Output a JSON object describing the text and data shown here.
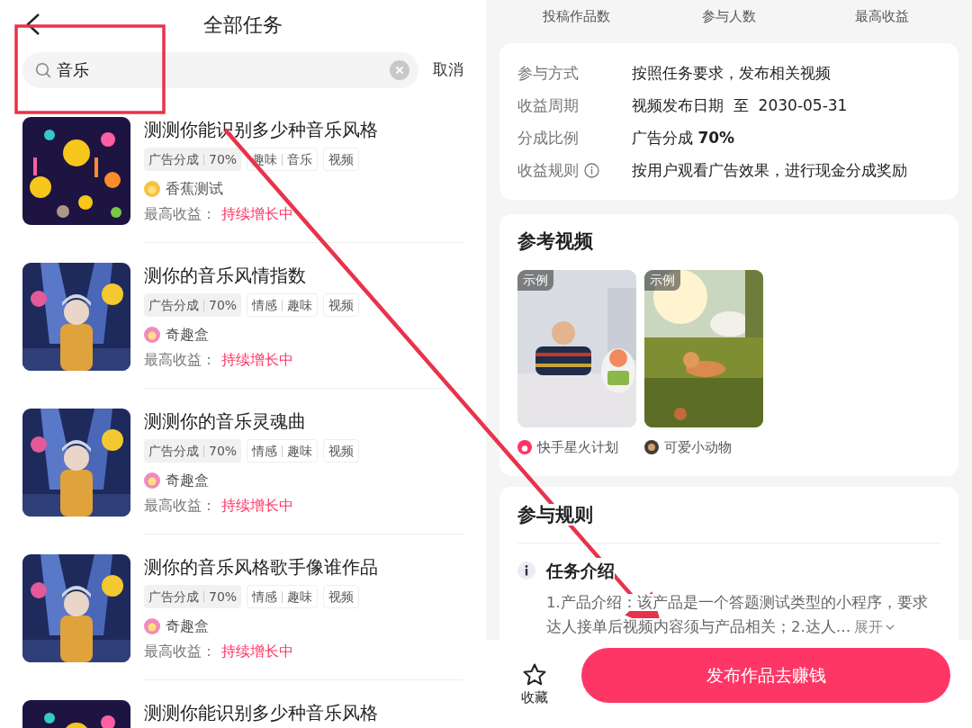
{
  "left": {
    "title": "全部任务",
    "search": {
      "value": "音乐"
    },
    "cancel": "取消",
    "tasks": [
      {
        "title": "测测你能识别多少种音乐风格",
        "tags": [
          {
            "kind": "share",
            "parts": [
              "广告分成",
              "70%"
            ]
          },
          {
            "kind": "plain",
            "parts": [
              "趣味",
              "音乐"
            ]
          },
          {
            "kind": "plain",
            "parts": [
              "视频"
            ]
          }
        ],
        "author": "香蕉测试",
        "earnings_label": "最高收益：",
        "earnings_value": "持续增长中"
      },
      {
        "title": "测你的音乐风情指数",
        "tags": [
          {
            "kind": "share",
            "parts": [
              "广告分成",
              "70%"
            ]
          },
          {
            "kind": "plain",
            "parts": [
              "情感",
              "趣味"
            ]
          },
          {
            "kind": "plain",
            "parts": [
              "视频"
            ]
          }
        ],
        "author": "奇趣盒",
        "earnings_label": "最高收益：",
        "earnings_value": "持续增长中"
      },
      {
        "title": "测测你的音乐灵魂曲",
        "tags": [
          {
            "kind": "share",
            "parts": [
              "广告分成",
              "70%"
            ]
          },
          {
            "kind": "plain",
            "parts": [
              "情感",
              "趣味"
            ]
          },
          {
            "kind": "plain",
            "parts": [
              "视频"
            ]
          }
        ],
        "author": "奇趣盒",
        "earnings_label": "最高收益：",
        "earnings_value": "持续增长中"
      },
      {
        "title": "测你的音乐风格歌手像谁作品",
        "tags": [
          {
            "kind": "share",
            "parts": [
              "广告分成",
              "70%"
            ]
          },
          {
            "kind": "plain",
            "parts": [
              "情感",
              "趣味"
            ]
          },
          {
            "kind": "plain",
            "parts": [
              "视频"
            ]
          }
        ],
        "author": "奇趣盒",
        "earnings_label": "最高收益：",
        "earnings_value": "持续增长中"
      },
      {
        "title": "测测你能识别多少种音乐风格"
      }
    ]
  },
  "right": {
    "stats": [
      "投稿作品数",
      "参与人数",
      "最高收益"
    ],
    "details": [
      {
        "label": "参与方式",
        "value": "按照任务要求，发布相关视频",
        "info": false
      },
      {
        "label": "收益周期",
        "value": "视频发布日期  至  2030-05-31",
        "info": false
      },
      {
        "label": "分成比例",
        "value": "广告分成 **70%**",
        "info": false
      },
      {
        "label": "收益规则",
        "value": "按用户观看广告效果，进行现金分成奖励",
        "info": true
      }
    ],
    "reference": {
      "title": "参考视频",
      "videos": [
        {
          "badge": "示例",
          "author": "快手星火计划"
        },
        {
          "badge": "示例",
          "author": "可爱小动物"
        }
      ]
    },
    "rules": {
      "title": "参与规则",
      "section_title": "任务介绍",
      "text": "1.产品介绍：该产品是一个答题测试类型的小程序，要求达人接单后视频内容须与产品相关；2.达人…",
      "expand": "展开"
    },
    "bottom": {
      "favorite": "收藏",
      "publish": "发布作品去赚钱"
    }
  },
  "annotations": [
    {
      "kind": "highlight-frame"
    },
    {
      "kind": "arrow"
    }
  ]
}
